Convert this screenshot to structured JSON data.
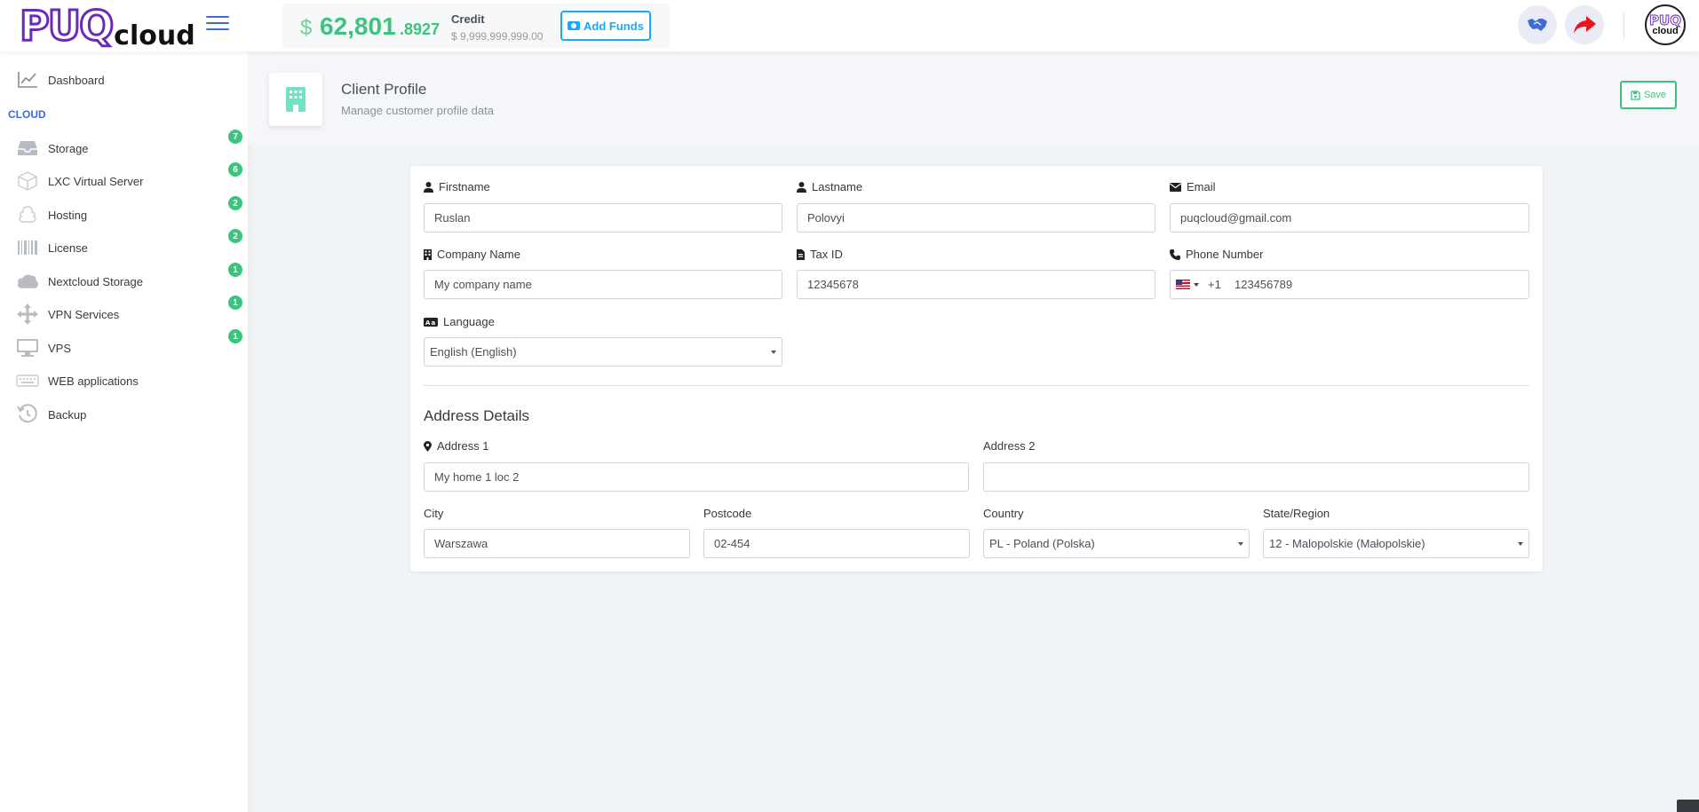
{
  "header": {
    "logo_main": "PUQ",
    "logo_sub": "cloud",
    "balance": {
      "currency": "$",
      "integer": "62,801",
      "decimal": ".8927"
    },
    "credit_label": "Credit",
    "credit_value": "$ 9,999,999,999.00",
    "add_funds_label": "Add Funds",
    "avatar_line1": "PUQ",
    "avatar_line2": "cloud"
  },
  "sidebar": {
    "dashboard_label": "Dashboard",
    "section_heading": "CLOUD",
    "items": [
      {
        "label": "Storage",
        "badge": "7",
        "icon": "inbox-icon"
      },
      {
        "label": "LXC Virtual Server",
        "badge": "6",
        "icon": "cube-icon"
      },
      {
        "label": "Hosting",
        "badge": "2",
        "icon": "cloud-stack-icon"
      },
      {
        "label": "License",
        "badge": "2",
        "icon": "barcode-icon"
      },
      {
        "label": "Nextcloud Storage",
        "badge": "1",
        "icon": "cloud-icon"
      },
      {
        "label": "VPN Services",
        "badge": "1",
        "icon": "arrows-icon"
      },
      {
        "label": "VPS",
        "badge": "1",
        "icon": "monitor-icon"
      },
      {
        "label": "WEB applications",
        "badge": "",
        "icon": "keyboard-icon"
      },
      {
        "label": "Backup",
        "badge": "",
        "icon": "history-icon"
      }
    ]
  },
  "page": {
    "title": "Client Profile",
    "subtitle": "Manage customer profile data",
    "save_label": "Save"
  },
  "form": {
    "firstname": {
      "label": "Firstname",
      "value": "Ruslan"
    },
    "lastname": {
      "label": "Lastname",
      "value": "Polovyi"
    },
    "email": {
      "label": "Email",
      "value": "puqcloud@gmail.com"
    },
    "company": {
      "label": "Company Name",
      "value": "My company name"
    },
    "tax_id": {
      "label": "Tax ID",
      "value": "12345678"
    },
    "phone": {
      "label": "Phone Number",
      "dial_code": "+1",
      "value": "123456789"
    },
    "language": {
      "label": "Language",
      "value": "English (English)"
    },
    "address_title": "Address Details",
    "address1": {
      "label": "Address 1",
      "value": "My home 1 loc 2"
    },
    "address2": {
      "label": "Address 2",
      "value": ""
    },
    "city": {
      "label": "City",
      "value": "Warszawa"
    },
    "postcode": {
      "label": "Postcode",
      "value": "02-454"
    },
    "country": {
      "label": "Country",
      "value": "PL - Poland (Polska)"
    },
    "state": {
      "label": "State/Region",
      "value": "12 - Malopolskie (Małopolskie)"
    }
  },
  "colors": {
    "accent": "#3f6ad8",
    "success": "#3ac47d",
    "info": "#16aaff",
    "brand_purple": "#6a2bb8"
  }
}
